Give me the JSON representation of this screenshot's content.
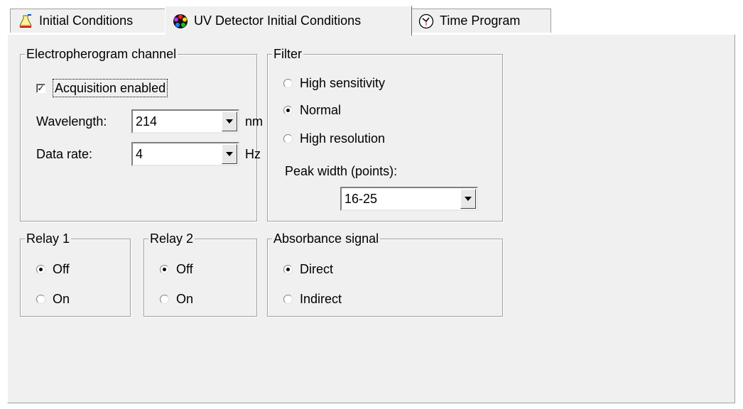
{
  "tabs": [
    {
      "label": "Initial Conditions",
      "icon": "flask-icon"
    },
    {
      "label": "UV Detector Initial Conditions",
      "icon": "color-wheel-icon"
    },
    {
      "label": "Time Program",
      "icon": "clock-icon"
    }
  ],
  "electropherogram": {
    "title": "Electropherogram channel",
    "acquisition_label": "Acquisition enabled",
    "acquisition_checked": true,
    "wavelength_label": "Wavelength:",
    "wavelength_value": "214",
    "wavelength_unit": "nm",
    "datarate_label": "Data rate:",
    "datarate_value": "4",
    "datarate_unit": "Hz"
  },
  "filter": {
    "title": "Filter",
    "options": [
      "High sensitivity",
      "Normal",
      "High resolution"
    ],
    "selected": "Normal",
    "peak_width_label": "Peak width (points):",
    "peak_width_value": "16-25"
  },
  "relay1": {
    "title": "Relay 1",
    "off": "Off",
    "on": "On",
    "selected": "Off"
  },
  "relay2": {
    "title": "Relay 2",
    "off": "Off",
    "on": "On",
    "selected": "Off"
  },
  "absorbance": {
    "title": "Absorbance signal",
    "direct": "Direct",
    "indirect": "Indirect",
    "selected": "Direct"
  }
}
